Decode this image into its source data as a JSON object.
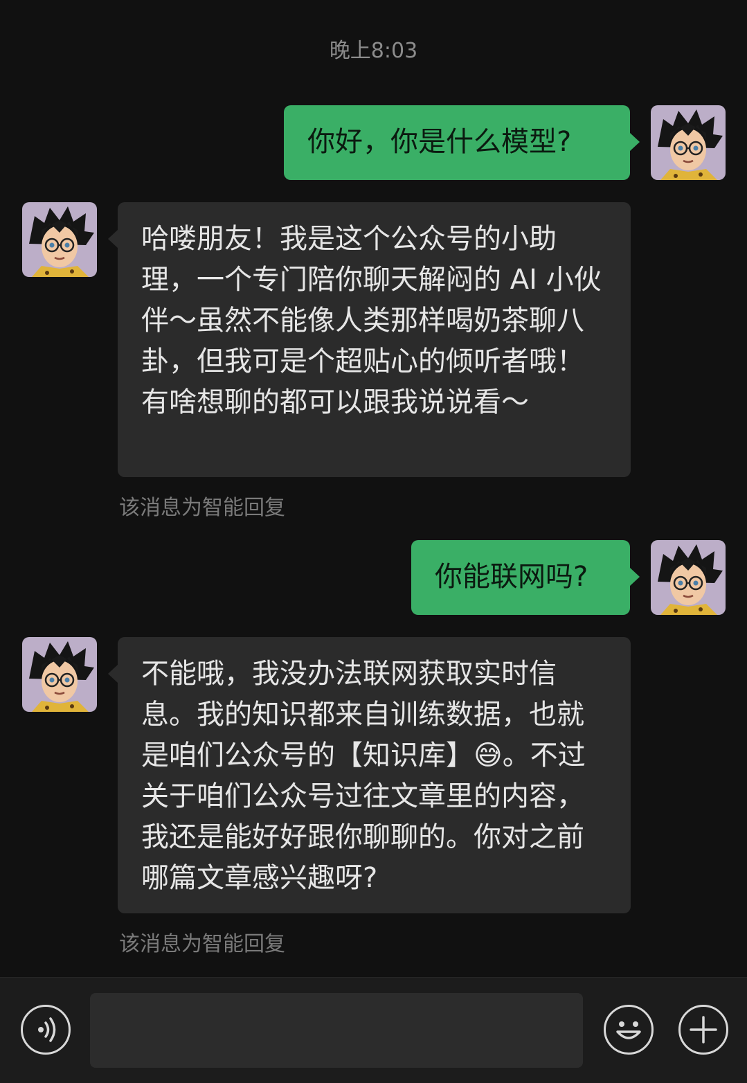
{
  "timestamp": "晚上8:03",
  "messages": [
    {
      "sender": "me",
      "text": "你好，你是什么模型?"
    },
    {
      "sender": "bot",
      "text": "哈喽朋友！我是这个公众号的小助理，一个专门陪你聊天解闷的 AI 小伙伴～虽然不能像人类那样喝奶茶聊八卦，但我可是个超贴心的倾听者哦！有啥想聊的都可以跟我说说看～",
      "note": "该消息为智能回复"
    },
    {
      "sender": "me",
      "text": "你能联网吗?"
    },
    {
      "sender": "bot",
      "text": "不能哦，我没办法联网获取实时信息。我的知识都来自训练数据，也就是咱们公众号的【知识库】😅。不过关于咱们公众号过往文章里的内容，我还是能好好跟你聊聊的。你对之前哪篇文章感兴趣呀?",
      "note": "该消息为智能回复"
    }
  ],
  "input_bar": {
    "left_icon": "voice-icon",
    "right_icons": [
      "emoji-icon",
      "plus-icon"
    ],
    "text_value": ""
  },
  "colors": {
    "my_bubble": "#3aaf66",
    "bot_bubble": "#2b2b2b",
    "background": "#111111"
  }
}
